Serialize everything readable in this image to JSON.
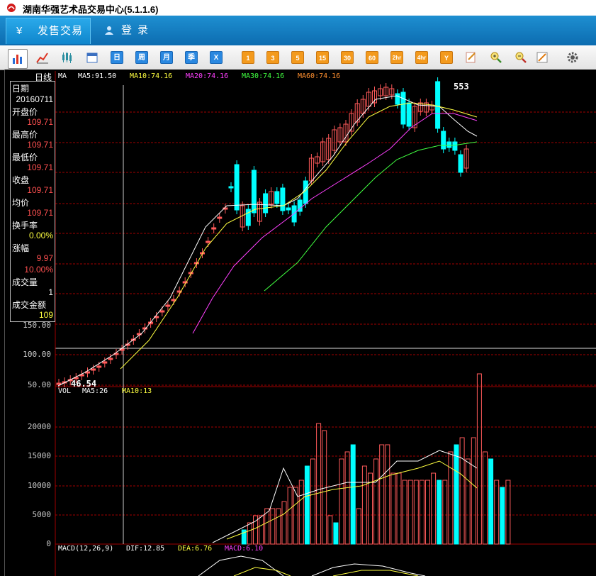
{
  "window": {
    "title": "湖南华强艺术品交易中心(5.1.1.6)"
  },
  "nav": {
    "tabs": [
      {
        "label": "发售交易",
        "icon": "yen-icon"
      },
      {
        "label": "登录",
        "icon": "user-icon"
      }
    ]
  },
  "toolbar": {
    "chart_icons": [
      "bar-chart-icon",
      "line-chart-icon",
      "candlestick-icon",
      "calendar-icon"
    ],
    "period_buttons": [
      "日",
      "周",
      "月",
      "季",
      "X"
    ],
    "minute_buttons": [
      "1",
      "3",
      "5",
      "15",
      "30",
      "60",
      "2hr",
      "4hr",
      "Y"
    ],
    "tool_icons": [
      "edit-icon",
      "zoom-in-icon",
      "zoom-out-icon",
      "draw-icon",
      "settings-icon"
    ]
  },
  "price_panel": {
    "period_label": "日线",
    "ma_label": "MA",
    "ma5": "MA5:91.50",
    "ma10": "MA10:74.16",
    "ma20": "MA20:74.16",
    "ma30": "MA30:74.16",
    "ma60": "MA60:74.16",
    "max_label": "553",
    "min_label": "46.54",
    "axis_ticks": [
      "150.00",
      "100.00",
      "50.00"
    ]
  },
  "info": {
    "date_label": "日期",
    "date_value": "20160711",
    "open_label": "开盘价",
    "open_value": "109.71",
    "high_label": "最高价",
    "high_value": "109.71",
    "low_label": "最低价",
    "low_value": "109.71",
    "close_label": "收盘",
    "close_value": "109.71",
    "avg_label": "均价",
    "avg_value": "109.71",
    "turnover_label": "换手率",
    "turnover_value": "0.00%",
    "change_label": "涨幅",
    "change_value": "9.97",
    "change_pct": "10.00%",
    "volume_label": "成交量",
    "volume_value": "1",
    "amount_label": "成交金额",
    "amount_value": "109"
  },
  "volume_panel": {
    "label": "VOL",
    "ma5": "MA5:26",
    "ma10": "MA10:13",
    "axis_ticks": [
      "20000",
      "15000",
      "10000",
      "5000",
      "0"
    ]
  },
  "macd_panel": {
    "label": "MACD(12,26,9)",
    "dif": "DIF:12.85",
    "dea": "DEA:6.76",
    "macd": "MACD:6.10"
  },
  "colors": {
    "up": "#ff5a5a",
    "down": "#00ffff",
    "ma5": "#ffffff",
    "ma10": "#ffff40",
    "ma20": "#ff40ff",
    "ma30": "#40ff40",
    "ma60": "#ff9030"
  }
}
